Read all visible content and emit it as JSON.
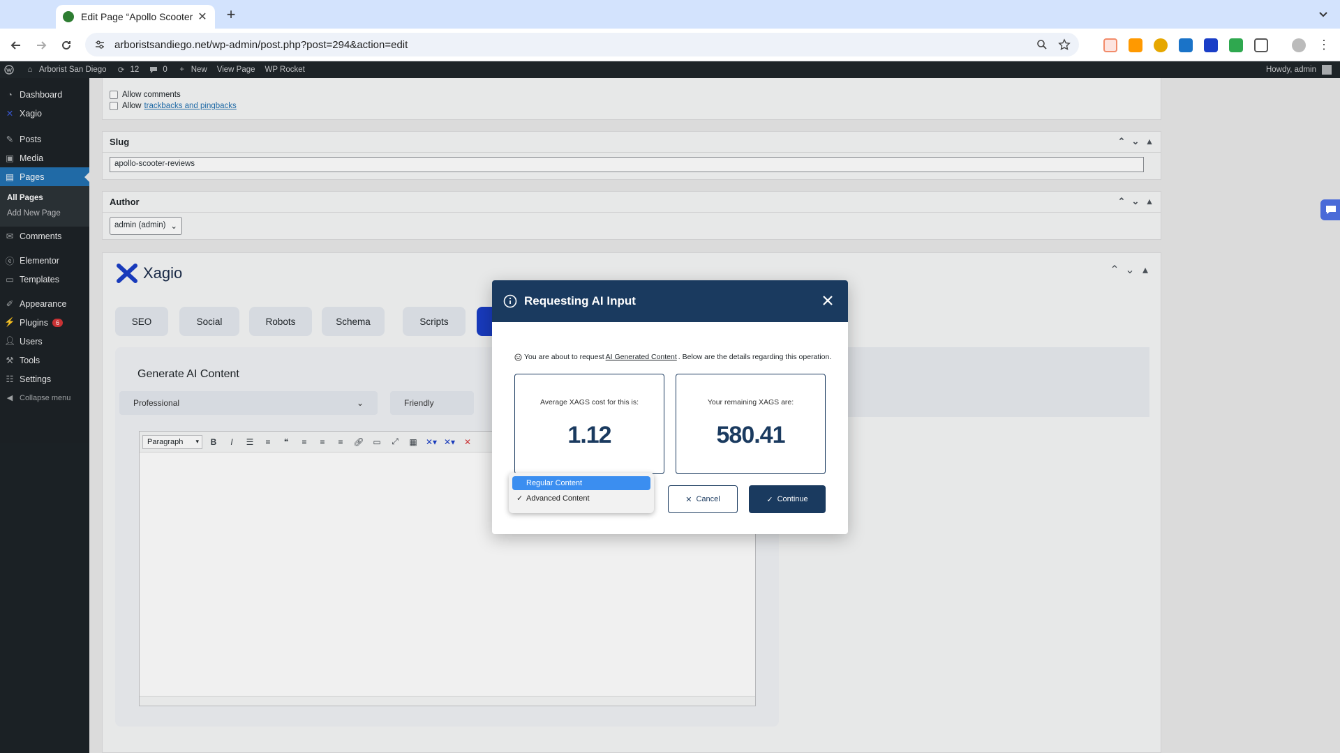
{
  "browser": {
    "tab_title": "Edit Page “Apollo Scooter Re",
    "url": "arboristsandiego.net/wp-admin/post.php?post=294&action=edit"
  },
  "adminbar": {
    "site_name": "Arborist San Diego",
    "updates_count": "12",
    "comments_count": "0",
    "new_label": "New",
    "view_page": "View Page",
    "wp_rocket": "WP Rocket",
    "howdy": "Howdy, admin"
  },
  "sidebar": {
    "items": [
      {
        "label": "Dashboard",
        "icon": "dashboard-icon"
      },
      {
        "label": "Xagio",
        "icon": "xagio-icon"
      },
      {
        "label": "Posts",
        "icon": "pin-icon"
      },
      {
        "label": "Media",
        "icon": "media-icon"
      },
      {
        "label": "Pages",
        "icon": "pages-icon"
      },
      {
        "label": "Comments",
        "icon": "comment-icon"
      },
      {
        "label": "Elementor",
        "icon": "elementor-icon"
      },
      {
        "label": "Templates",
        "icon": "folder-icon"
      },
      {
        "label": "Appearance",
        "icon": "brush-icon"
      },
      {
        "label": "Plugins",
        "icon": "plugin-icon"
      },
      {
        "label": "Users",
        "icon": "user-icon"
      },
      {
        "label": "Tools",
        "icon": "wrench-icon"
      },
      {
        "label": "Settings",
        "icon": "settings-icon"
      },
      {
        "label": "Collapse menu",
        "icon": "collapse-icon"
      }
    ],
    "pages_sub": [
      "All Pages",
      "Add New Page"
    ],
    "plugins_badge": "6"
  },
  "discussion": {
    "allow_comments": "Allow comments",
    "allow_prefix": "Allow",
    "trackbacks_link": "trackbacks and pingbacks"
  },
  "slug": {
    "title": "Slug",
    "value": "apollo-scooter-reviews"
  },
  "author": {
    "title": "Author",
    "value": "admin (admin)"
  },
  "xagio": {
    "brand": "Xagio",
    "tabs": [
      "SEO",
      "Social",
      "Robots",
      "Schema",
      "Scripts"
    ],
    "gen_title": "Generate AI Content",
    "tone1": "Professional",
    "tone2": "Friendly",
    "editor_format": "Paragraph"
  },
  "modal": {
    "title": "Requesting AI Input",
    "note_pre": "You are about to request",
    "note_link": "AI Generated Content",
    "note_post": ". Below are the details regarding this operation.",
    "avg_label": "Average XAGS cost for this is:",
    "avg_value": "1.12",
    "remaining_label": "Your remaining XAGS are:",
    "remaining_value": "580.41",
    "options": [
      "Regular Content",
      "Advanced Content"
    ],
    "selected_option": "Advanced Content",
    "cancel": "Cancel",
    "continue": "Continue"
  },
  "colors": {
    "modal_header": "#1a3a5f",
    "highlight": "#3b8ef0",
    "wp_blue": "#2271b1"
  }
}
